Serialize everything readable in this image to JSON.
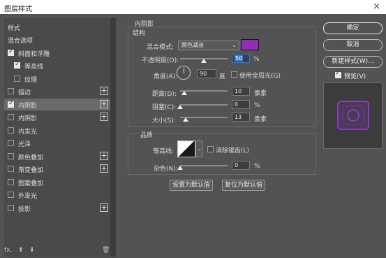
{
  "window": {
    "title": "图层样式",
    "close_label": "×"
  },
  "sidebar": {
    "items": [
      {
        "label": "样式",
        "checkbox": false,
        "checked": false,
        "plus": false,
        "selected": false
      },
      {
        "label": "混合选项",
        "checkbox": false,
        "checked": false,
        "plus": false,
        "selected": false
      },
      {
        "label": "斜面和浮雕",
        "checkbox": true,
        "checked": true,
        "plus": false,
        "selected": false
      },
      {
        "label": "等高线",
        "checkbox": true,
        "checked": true,
        "plus": false,
        "selected": false,
        "indent": true
      },
      {
        "label": "纹理",
        "checkbox": true,
        "checked": false,
        "plus": false,
        "selected": false,
        "indent": true
      },
      {
        "label": "描边",
        "checkbox": true,
        "checked": false,
        "plus": true,
        "selected": false
      },
      {
        "label": "内阴影",
        "checkbox": true,
        "checked": true,
        "plus": true,
        "selected": true
      },
      {
        "label": "内阴影",
        "checkbox": true,
        "checked": false,
        "plus": true,
        "selected": false
      },
      {
        "label": "内发光",
        "checkbox": true,
        "checked": false,
        "plus": false,
        "selected": false
      },
      {
        "label": "光泽",
        "checkbox": true,
        "checked": false,
        "plus": false,
        "selected": false
      },
      {
        "label": "颜色叠加",
        "checkbox": true,
        "checked": false,
        "plus": true,
        "selected": false
      },
      {
        "label": "渐变叠加",
        "checkbox": true,
        "checked": false,
        "plus": true,
        "selected": false
      },
      {
        "label": "图案叠加",
        "checkbox": true,
        "checked": false,
        "plus": false,
        "selected": false
      },
      {
        "label": "外发光",
        "checkbox": true,
        "checked": false,
        "plus": false,
        "selected": false
      },
      {
        "label": "投影",
        "checkbox": true,
        "checked": false,
        "plus": true,
        "selected": false
      }
    ],
    "footer": {
      "fx": "fx.",
      "up": "⬆",
      "down": "⬇",
      "trash": "🗑"
    }
  },
  "panel": {
    "title": "内阴影",
    "structure": {
      "heading": "结构",
      "blend_mode_label": "混合模式:",
      "blend_mode_value": "颜色减淡",
      "color": "#8e2fb4",
      "opacity_label": "不透明度(O):",
      "opacity_value": "50",
      "opacity_unit": "%",
      "opacity_fraction": 0.5,
      "angle_label": "角度(A):",
      "angle_value": "90",
      "angle_unit": "度",
      "global_light_label": "使用全局光(G)",
      "distance_label": "距离(D):",
      "distance_value": "10",
      "distance_unit": "像素",
      "choke_label": "阻塞(C):",
      "choke_value": "0",
      "choke_unit": "%",
      "size_label": "大小(S):",
      "size_value": "13",
      "size_unit": "像素"
    },
    "quality": {
      "heading": "品质",
      "contour_label": "等高线:",
      "antialias_label": "消除锯齿(L)",
      "noise_label": "杂色(N):",
      "noise_value": "0",
      "noise_unit": "%"
    },
    "buttons": {
      "make_default": "设置为默认值",
      "reset_default": "复位为默认值"
    }
  },
  "actions": {
    "ok": "确定",
    "cancel": "取消",
    "new_style": "新建样式(W)...",
    "preview_label": "预览(V)",
    "preview_checked": true
  }
}
